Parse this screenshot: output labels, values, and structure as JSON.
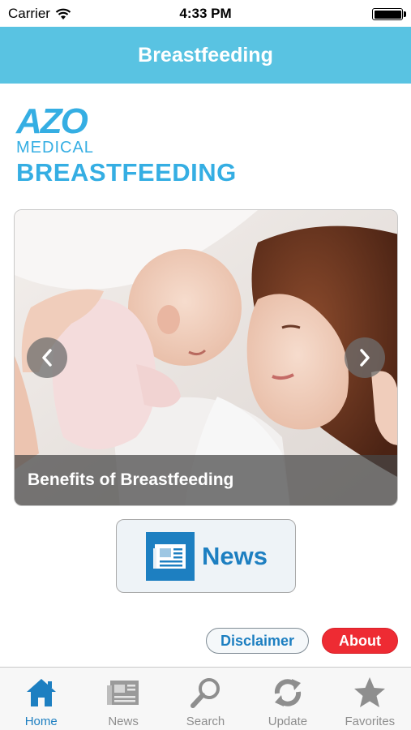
{
  "status_bar": {
    "carrier": "Carrier",
    "time": "4:33 PM"
  },
  "nav": {
    "title": "Breastfeeding"
  },
  "logo": {
    "brand": "AZO",
    "sub": "MEDICAL",
    "product": "BREASTFEEDING"
  },
  "slider": {
    "caption": "Benefits of Breastfeeding"
  },
  "news_button": {
    "label": "News"
  },
  "buttons": {
    "disclaimer": "Disclaimer",
    "about": "About"
  },
  "tabs": [
    {
      "label": "Home",
      "icon": "home-icon",
      "active": true
    },
    {
      "label": "News",
      "icon": "newspaper-icon",
      "active": false
    },
    {
      "label": "Search",
      "icon": "search-icon",
      "active": false
    },
    {
      "label": "Update",
      "icon": "refresh-icon",
      "active": false
    },
    {
      "label": "Favorites",
      "icon": "star-icon",
      "active": false
    }
  ],
  "colors": {
    "nav_bg": "#59c3e2",
    "brand_blue": "#35aee3",
    "link_blue": "#1d7fc1",
    "about_red": "#ee2b33"
  }
}
